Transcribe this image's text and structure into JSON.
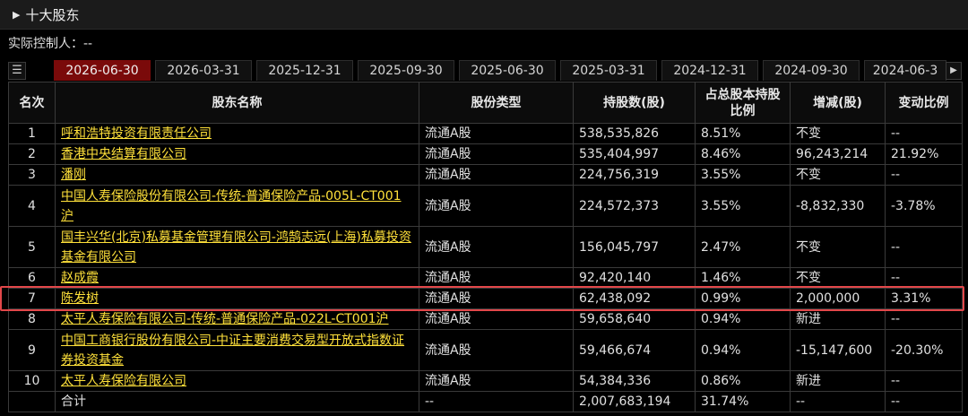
{
  "section": {
    "title": "十大股东"
  },
  "controller": {
    "text": "实际控制人：--"
  },
  "tabs": [
    {
      "label": "2026-06-30",
      "active": true
    },
    {
      "label": "2026-03-31"
    },
    {
      "label": "2025-12-31"
    },
    {
      "label": "2025-09-30"
    },
    {
      "label": "2025-06-30"
    },
    {
      "label": "2025-03-31"
    },
    {
      "label": "2024-12-31"
    },
    {
      "label": "2024-09-30"
    },
    {
      "label": "2024-06-3"
    }
  ],
  "table": {
    "headers": {
      "rank": "名次",
      "name": "股东名称",
      "type": "股份类型",
      "shares": "持股数(股)",
      "ratio": "占总股本持股比例",
      "change": "增减(股)",
      "change_pct": "变动比例"
    },
    "rows": [
      {
        "rank": "1",
        "name": "呼和浩特投资有限责任公司",
        "type": "流通A股",
        "shares": "538,535,826",
        "ratio": "8.51%",
        "change": "不变",
        "change_pct": "--",
        "dir": "flat"
      },
      {
        "rank": "2",
        "name": "香港中央结算有限公司",
        "type": "流通A股",
        "shares": "535,404,997",
        "ratio": "8.46%",
        "change": "96,243,214",
        "change_pct": "21.92%",
        "dir": "up"
      },
      {
        "rank": "3",
        "name": "潘刚",
        "type": "流通A股",
        "shares": "224,756,319",
        "ratio": "3.55%",
        "change": "不变",
        "change_pct": "--",
        "dir": "flat"
      },
      {
        "rank": "4",
        "name": "中国人寿保险股份有限公司-传统-普通保险产品-005L-CT001沪",
        "type": "流通A股",
        "shares": "224,572,373",
        "ratio": "3.55%",
        "change": "-8,832,330",
        "change_pct": "-3.78%",
        "dir": "down",
        "tall": true
      },
      {
        "rank": "5",
        "name": "国丰兴华(北京)私募基金管理有限公司-鸿鹄志远(上海)私募投资基金有限公司",
        "type": "流通A股",
        "shares": "156,045,797",
        "ratio": "2.47%",
        "change": "不变",
        "change_pct": "--",
        "dir": "flat",
        "tall": true
      },
      {
        "rank": "6",
        "name": "赵成霞",
        "type": "流通A股",
        "shares": "92,420,140",
        "ratio": "1.46%",
        "change": "不变",
        "change_pct": "--",
        "dir": "flat"
      },
      {
        "rank": "7",
        "name": "陈发树",
        "type": "流通A股",
        "shares": "62,438,092",
        "ratio": "0.99%",
        "change": "2,000,000",
        "change_pct": "3.31%",
        "dir": "up"
      },
      {
        "rank": "8",
        "name": "太平人寿保险有限公司-传统-普通保险产品-022L-CT001沪",
        "type": "流通A股",
        "shares": "59,658,640",
        "ratio": "0.94%",
        "change": "新进",
        "change_pct": "--",
        "dir": "new"
      },
      {
        "rank": "9",
        "name": "中国工商银行股份有限公司-中证主要消费交易型开放式指数证券投资基金",
        "type": "流通A股",
        "shares": "59,466,674",
        "ratio": "0.94%",
        "change": "-15,147,600",
        "change_pct": "-20.30%",
        "dir": "down",
        "tall": true
      },
      {
        "rank": "10",
        "name": "太平人寿保险有限公司",
        "type": "流通A股",
        "shares": "54,384,336",
        "ratio": "0.86%",
        "change": "新进",
        "change_pct": "--",
        "dir": "new"
      }
    ],
    "total": {
      "label": "合计",
      "type": "--",
      "shares": "2,007,683,194",
      "ratio": "31.74%",
      "change": "--",
      "change_pct": "--"
    }
  },
  "colors": {
    "background": "#000000",
    "active_tab": "#7a0a0a",
    "link": "#ffe13a",
    "increase": "#ff4a4a",
    "decrease": "#22d84a",
    "highlight": "#e2474a"
  },
  "icons": {
    "collapse": "triangle-right-icon",
    "list": "list-icon",
    "next": "chevron-right-icon"
  }
}
